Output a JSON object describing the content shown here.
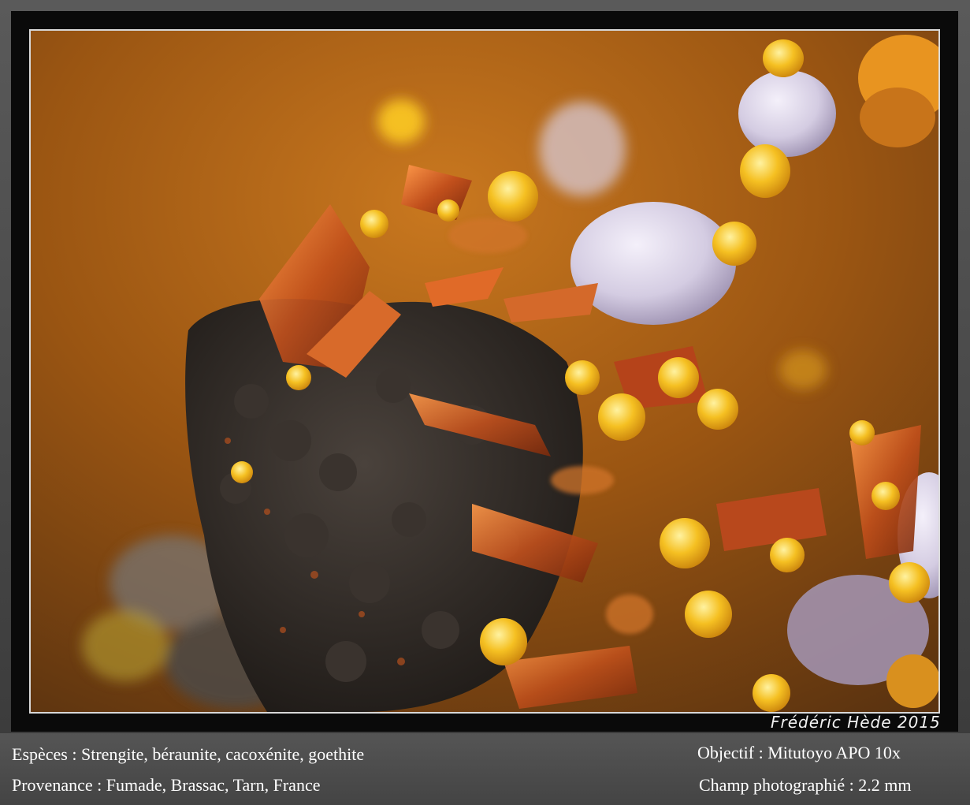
{
  "caption": {
    "species": "Espèces : Strengite, béraunite, cacoxénite, goethite",
    "origin": "Provenance : Fumade, Brassac, Tarn, France",
    "objective": "Objectif : Mitutoyo APO 10x",
    "field": "Champ photographié : 2.2  mm"
  },
  "signature": "Frédéric Hède 2015",
  "colors": {
    "background_amber": "#b86a1e",
    "goethite_dark": "#2e2a26",
    "beraunite_red": "#b5431a",
    "cacoxenite_yellow": "#f2b41c",
    "strengite_lavender": "#d9d3e6"
  }
}
